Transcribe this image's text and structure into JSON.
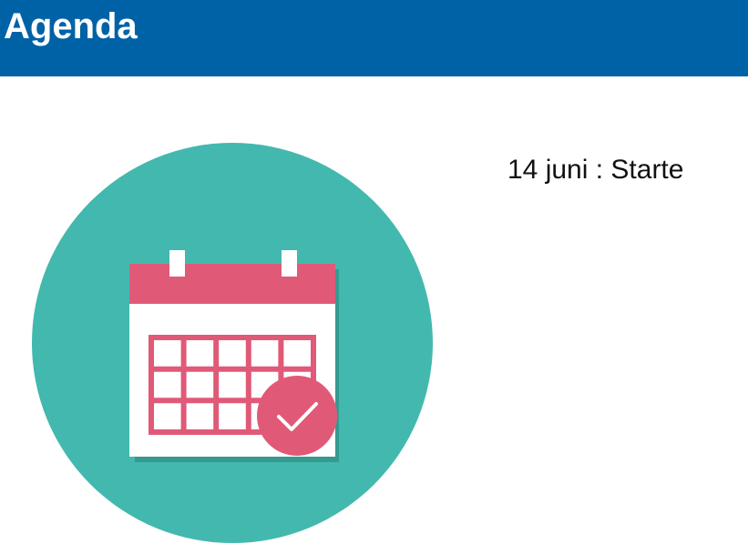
{
  "header": {
    "title": "Agenda"
  },
  "agenda": {
    "items": [
      {
        "text": "14 juni : Starte"
      }
    ]
  },
  "colors": {
    "header_background": "#0062a6",
    "circle": "#43b8ae",
    "calendar_accent": "#e05a78",
    "calendar_paper": "#ffffff",
    "calendar_shadow": "#36998f"
  },
  "icons": {
    "illustration": "calendar-check-icon"
  }
}
